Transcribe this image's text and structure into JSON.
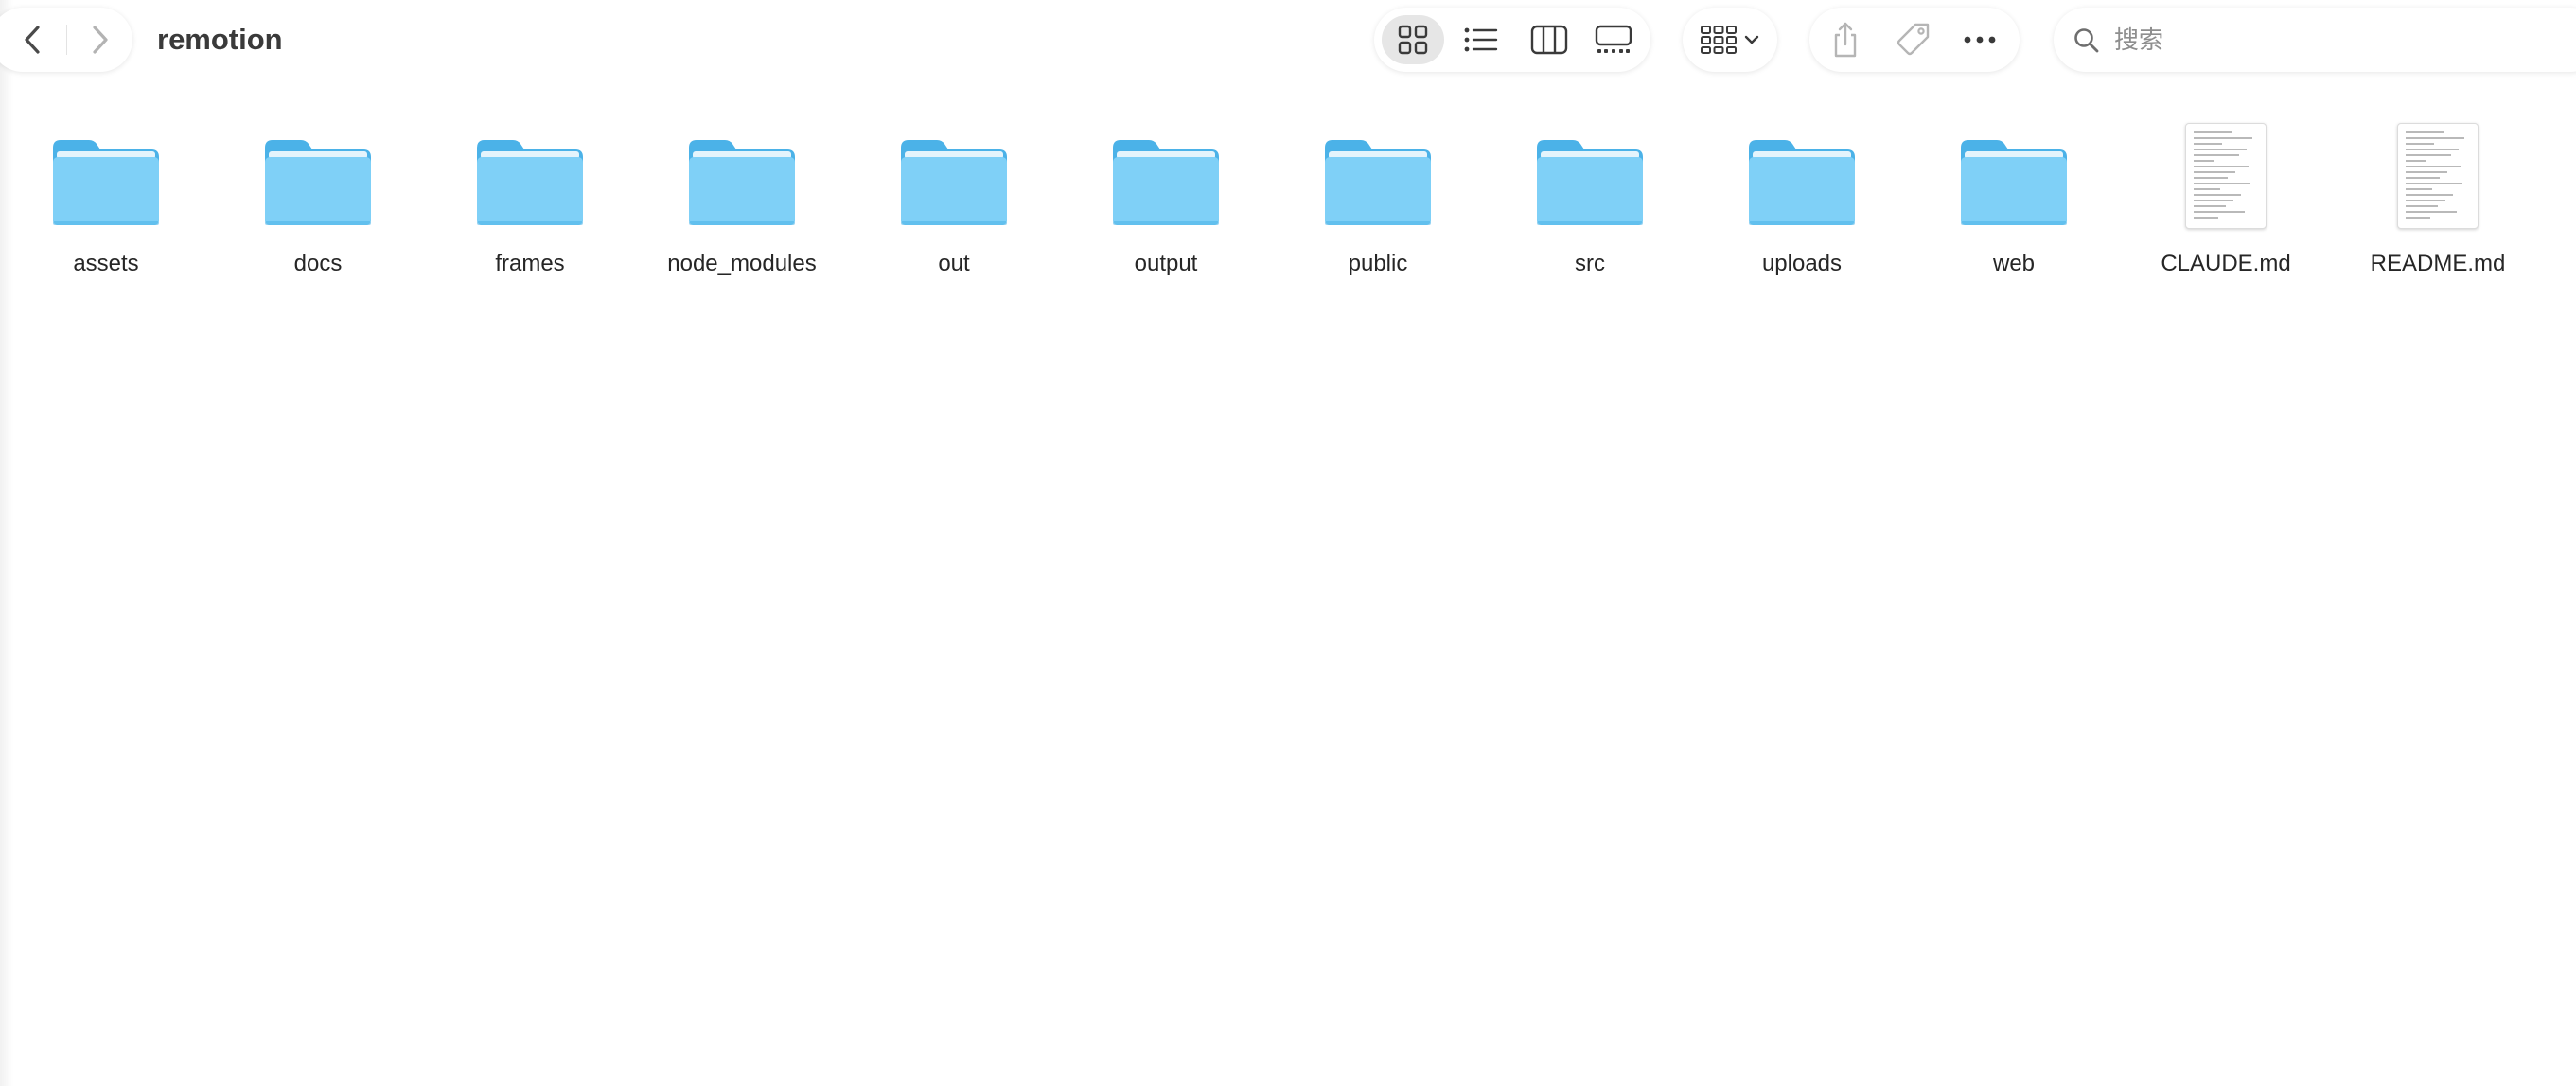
{
  "window": {
    "title": "remotion"
  },
  "toolbar": {
    "nav": {
      "back_icon": "chevron-left-icon",
      "forward_icon": "chevron-right-icon"
    },
    "view_modes": [
      {
        "name": "icon-view",
        "icon": "grid-icon",
        "active": true
      },
      {
        "name": "list-view",
        "icon": "list-icon",
        "active": false
      },
      {
        "name": "column-view",
        "icon": "columns-icon",
        "active": false
      },
      {
        "name": "gallery-view",
        "icon": "gallery-icon",
        "active": false
      }
    ],
    "group": {
      "icon": "group-grid-icon",
      "dropdown_icon": "chevron-down-icon"
    },
    "actions": [
      {
        "name": "share",
        "icon": "share-icon"
      },
      {
        "name": "tags",
        "icon": "tag-icon"
      },
      {
        "name": "more",
        "icon": "ellipsis-icon"
      }
    ],
    "search": {
      "placeholder": "搜索",
      "value": ""
    }
  },
  "colors": {
    "folder_light": "#7fd0f7",
    "folder_dark": "#4bb2e8",
    "accent": "#1e90e6"
  },
  "files": [
    {
      "name": "assets",
      "kind": "folder"
    },
    {
      "name": "docs",
      "kind": "folder"
    },
    {
      "name": "frames",
      "kind": "folder"
    },
    {
      "name": "node_modules",
      "kind": "folder"
    },
    {
      "name": "out",
      "kind": "folder"
    },
    {
      "name": "output",
      "kind": "folder"
    },
    {
      "name": "public",
      "kind": "folder"
    },
    {
      "name": "src",
      "kind": "folder"
    },
    {
      "name": "uploads",
      "kind": "folder"
    },
    {
      "name": "web",
      "kind": "folder"
    },
    {
      "name": "CLAUDE.md",
      "kind": "document"
    },
    {
      "name": "README.md",
      "kind": "document"
    }
  ]
}
